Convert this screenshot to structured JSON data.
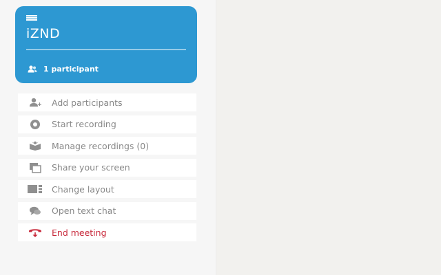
{
  "colors": {
    "header_bg": "#2d98d2",
    "sidebar_bg": "#f6f6f6",
    "main_bg": "#f2f1ee",
    "item_bg": "#ffffff",
    "label_text": "#888888",
    "icon_gray": "#8f8f8f",
    "danger": "#c8283a"
  },
  "header": {
    "menu_icon": "hamburger-menu-icon",
    "room_name": "iZND",
    "participants_icon": "participants-icon",
    "participants_label": "1 participant"
  },
  "actions": [
    {
      "label": "Add participants",
      "icon": "add-user-icon"
    },
    {
      "label": "Start recording",
      "icon": "record-icon"
    },
    {
      "label": "Manage recordings (0)",
      "icon": "recordings-box-icon"
    },
    {
      "label": "Share your screen",
      "icon": "screen-share-icon"
    },
    {
      "label": "Change layout",
      "icon": "layout-icon"
    },
    {
      "label": "Open text chat",
      "icon": "chat-bubbles-icon"
    },
    {
      "label": "End meeting",
      "icon": "hang-up-phone-icon"
    }
  ]
}
